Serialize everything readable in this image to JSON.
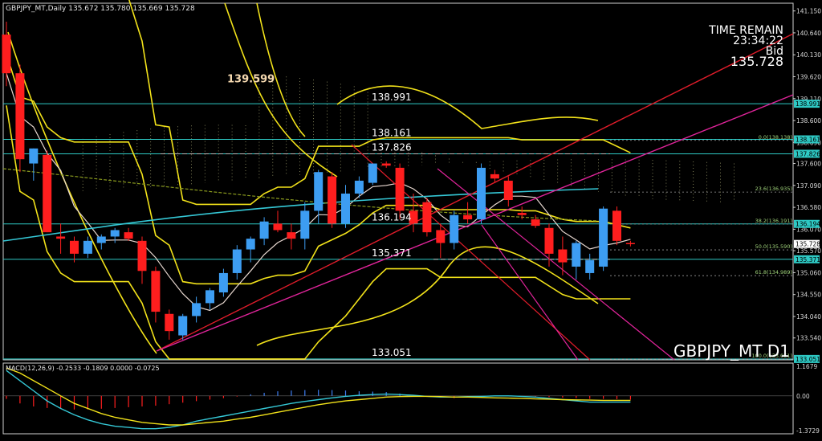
{
  "header": {
    "symbol_info": "GBPJPY_MT,Daily  135.672 135.780 135.669 135.728",
    "time_remain_label": "TIME REMAIN",
    "time_remain_value": "23:34:22",
    "bid_label": "Bid",
    "bid_value": "135.728",
    "watermark": "GBPJPY_MT D1",
    "macd_label": "MACD(12,26,9) -0.2533 -0.1809 0.0000 -0.0725"
  },
  "colors": {
    "background": "#000000",
    "bull": "#3d9df2",
    "bear": "#ff1e1e",
    "bollinger": "#f2e21a",
    "hline": "#2ec9c4",
    "trend_red": "#e01c2a",
    "trend_magenta": "#e0249a",
    "ma_cyan": "#35c8d6",
    "ma_white": "#e8d8d0",
    "ma_olive": "#8a9a1e",
    "ichimoku": "#9a9a6a",
    "macd_hist_neg": "#ff1e1e",
    "macd_hist_pos": "#3d7df2",
    "macd_main": "#35c8d6",
    "macd_signal": "#f2e21a",
    "highlight_label": "#f5d9b0"
  },
  "chart_data": {
    "type": "candlestick",
    "ylim": [
      133.03,
      141.33
    ],
    "y_ticks": [
      "141.150",
      "140.640",
      "140.130",
      "139.620",
      "139.110",
      "138.600",
      "138.090",
      "137.600",
      "137.090",
      "136.580",
      "136.070",
      "135.570",
      "135.060",
      "134.550",
      "134.040",
      "133.540"
    ],
    "candles": [
      {
        "o": 140.6,
        "h": 140.9,
        "l": 139.4,
        "c": 139.7
      },
      {
        "o": 139.7,
        "h": 139.9,
        "l": 137.4,
        "c": 137.7
      },
      {
        "o": 137.6,
        "h": 137.95,
        "l": 137.2,
        "c": 137.95
      },
      {
        "o": 137.8,
        "h": 137.9,
        "l": 136.0,
        "c": 136.0
      },
      {
        "o": 135.9,
        "h": 136.2,
        "l": 135.5,
        "c": 135.85
      },
      {
        "o": 135.8,
        "h": 135.9,
        "l": 135.3,
        "c": 135.5
      },
      {
        "o": 135.5,
        "h": 135.9,
        "l": 135.4,
        "c": 135.8
      },
      {
        "o": 135.75,
        "h": 135.95,
        "l": 135.6,
        "c": 135.9
      },
      {
        "o": 135.9,
        "h": 136.1,
        "l": 135.75,
        "c": 136.05
      },
      {
        "o": 136.0,
        "h": 136.1,
        "l": 135.8,
        "c": 135.85
      },
      {
        "o": 135.8,
        "h": 135.9,
        "l": 134.8,
        "c": 135.1
      },
      {
        "o": 135.1,
        "h": 135.2,
        "l": 133.9,
        "c": 134.15
      },
      {
        "o": 134.1,
        "h": 134.2,
        "l": 133.5,
        "c": 133.7
      },
      {
        "o": 133.6,
        "h": 134.1,
        "l": 133.5,
        "c": 134.05
      },
      {
        "o": 134.05,
        "h": 134.5,
        "l": 133.9,
        "c": 134.35
      },
      {
        "o": 134.35,
        "h": 134.7,
        "l": 134.2,
        "c": 134.65
      },
      {
        "o": 134.6,
        "h": 135.15,
        "l": 134.5,
        "c": 135.05
      },
      {
        "o": 135.05,
        "h": 135.7,
        "l": 134.9,
        "c": 135.6
      },
      {
        "o": 135.6,
        "h": 135.9,
        "l": 135.3,
        "c": 135.85
      },
      {
        "o": 135.85,
        "h": 136.35,
        "l": 135.7,
        "c": 136.25
      },
      {
        "o": 136.2,
        "h": 136.5,
        "l": 136.0,
        "c": 136.05
      },
      {
        "o": 136.0,
        "h": 136.2,
        "l": 135.6,
        "c": 135.85
      },
      {
        "o": 135.85,
        "h": 136.7,
        "l": 135.6,
        "c": 136.5
      },
      {
        "o": 136.5,
        "h": 137.45,
        "l": 136.2,
        "c": 137.4
      },
      {
        "o": 137.3,
        "h": 137.4,
        "l": 136.1,
        "c": 136.2
      },
      {
        "o": 136.2,
        "h": 137.1,
        "l": 136.1,
        "c": 136.9
      },
      {
        "o": 136.9,
        "h": 137.3,
        "l": 136.8,
        "c": 137.2
      },
      {
        "o": 137.15,
        "h": 137.6,
        "l": 137.1,
        "c": 137.6
      },
      {
        "o": 137.6,
        "h": 137.65,
        "l": 137.5,
        "c": 137.55
      },
      {
        "o": 137.5,
        "h": 137.6,
        "l": 136.3,
        "c": 136.5
      },
      {
        "o": 136.5,
        "h": 136.9,
        "l": 136.0,
        "c": 136.2
      },
      {
        "o": 136.7,
        "h": 136.8,
        "l": 135.9,
        "c": 136.0
      },
      {
        "o": 136.05,
        "h": 136.2,
        "l": 135.4,
        "c": 135.75
      },
      {
        "o": 135.75,
        "h": 136.5,
        "l": 135.6,
        "c": 136.4
      },
      {
        "o": 136.4,
        "h": 136.7,
        "l": 136.2,
        "c": 136.3
      },
      {
        "o": 136.3,
        "h": 137.6,
        "l": 136.2,
        "c": 137.5
      },
      {
        "o": 137.35,
        "h": 137.45,
        "l": 137.15,
        "c": 137.25
      },
      {
        "o": 137.2,
        "h": 137.3,
        "l": 136.6,
        "c": 136.75
      },
      {
        "o": 136.45,
        "h": 136.6,
        "l": 136.3,
        "c": 136.4
      },
      {
        "o": 136.3,
        "h": 136.4,
        "l": 136.1,
        "c": 136.15
      },
      {
        "o": 136.1,
        "h": 136.2,
        "l": 135.2,
        "c": 135.5
      },
      {
        "o": 135.6,
        "h": 135.9,
        "l": 135.0,
        "c": 135.3
      },
      {
        "o": 135.2,
        "h": 135.8,
        "l": 134.9,
        "c": 135.75
      },
      {
        "o": 135.05,
        "h": 135.5,
        "l": 134.9,
        "c": 135.35
      },
      {
        "o": 135.2,
        "h": 136.6,
        "l": 135.1,
        "c": 136.55
      },
      {
        "o": 136.5,
        "h": 136.6,
        "l": 135.7,
        "c": 135.8
      },
      {
        "o": 135.75,
        "h": 135.8,
        "l": 135.67,
        "c": 135.73
      }
    ],
    "fib_levels": [
      {
        "label": "0.0(138.138)",
        "value": 138.138
      },
      {
        "label": "23.6(136.935)",
        "value": 136.935
      },
      {
        "label": "38.2(136.191)",
        "value": 136.191
      },
      {
        "label": "50.0(135.590)",
        "value": 135.59
      },
      {
        "label": "61.8(134.989)",
        "value": 134.989
      },
      {
        "label": "100.0(133.051)",
        "value": 133.051
      }
    ],
    "hlines": [
      {
        "label": "138.991",
        "value": 138.991
      },
      {
        "label": "138.161",
        "value": 138.161
      },
      {
        "label": "137.826",
        "value": 137.826
      },
      {
        "label": "136.194",
        "value": 136.194
      },
      {
        "label": "135.371",
        "value": 135.371
      },
      {
        "label": "133.051",
        "value": 133.051
      }
    ],
    "price_tags": [
      "138.991",
      "138.161",
      "137.826",
      "136.194",
      "135.728",
      "135.371",
      "133.051"
    ],
    "current_price": 135.728,
    "highlight_label": "139.599",
    "highlight_value": 139.599,
    "macd": {
      "ylim": [
        -1.3729,
        1.1679
      ],
      "y_ticks": [
        "1.1679",
        "0.00",
        "-1.3729"
      ],
      "histogram": [
        -0.2,
        -0.5,
        -0.7,
        -0.8,
        -0.85,
        -0.9,
        -0.9,
        -0.85,
        -0.8,
        -0.75,
        -0.7,
        -0.65,
        -0.55,
        -0.45,
        -0.35,
        -0.25,
        -0.15,
        -0.05,
        0.1,
        0.2,
        0.3,
        0.35,
        0.38,
        0.4,
        0.38,
        0.35,
        0.3,
        0.28,
        0.25,
        0.15,
        0.05,
        -0.05,
        -0.12,
        -0.15,
        -0.1,
        -0.05,
        -0.02,
        0.0,
        -0.02,
        -0.05,
        -0.08,
        -0.12,
        -0.15,
        -0.2,
        -0.2,
        -0.22,
        -0.25
      ],
      "main": [
        1.0,
        0.6,
        0.2,
        -0.2,
        -0.5,
        -0.75,
        -0.95,
        -1.1,
        -1.2,
        -1.25,
        -1.3,
        -1.3,
        -1.25,
        -1.15,
        -1.0,
        -0.9,
        -0.8,
        -0.7,
        -0.6,
        -0.5,
        -0.4,
        -0.3,
        -0.22,
        -0.15,
        -0.08,
        -0.02,
        0.02,
        0.05,
        0.07,
        0.05,
        0.02,
        -0.02,
        -0.05,
        -0.05,
        -0.03,
        -0.02,
        0.0,
        0.0,
        -0.02,
        -0.05,
        -0.1,
        -0.15,
        -0.2,
        -0.25,
        -0.25,
        -0.25,
        -0.25
      ],
      "signal": [
        1.1,
        0.9,
        0.6,
        0.3,
        0.0,
        -0.3,
        -0.5,
        -0.7,
        -0.85,
        -0.95,
        -1.05,
        -1.1,
        -1.15,
        -1.15,
        -1.1,
        -1.05,
        -1.0,
        -0.92,
        -0.85,
        -0.75,
        -0.65,
        -0.55,
        -0.45,
        -0.35,
        -0.27,
        -0.2,
        -0.15,
        -0.1,
        -0.05,
        -0.03,
        -0.02,
        -0.02,
        -0.03,
        -0.05,
        -0.05,
        -0.06,
        -0.08,
        -0.09,
        -0.1,
        -0.12,
        -0.13,
        -0.15,
        -0.16,
        -0.17,
        -0.18,
        -0.18,
        -0.18
      ]
    }
  }
}
